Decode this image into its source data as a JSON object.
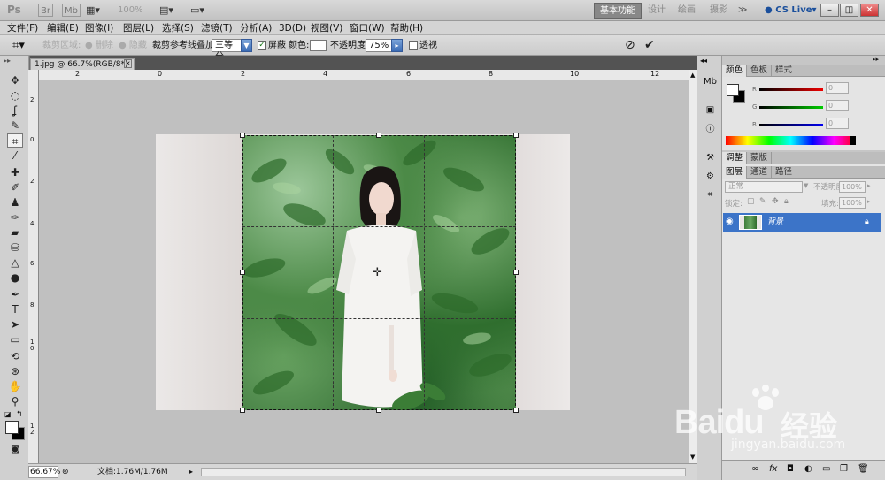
{
  "app": {
    "logo": "Ps",
    "br_label": "Br",
    "mb_label": "Mb",
    "zoom": "100%",
    "workspaces": [
      "基本功能",
      "设计",
      "绘画",
      "摄影"
    ],
    "more": "≫",
    "cslive": "CS Live▾",
    "win_controls": [
      "–",
      "◫",
      "✕"
    ]
  },
  "menu": [
    {
      "label": "文件(F)"
    },
    {
      "label": "编辑(E)"
    },
    {
      "label": "图像(I)"
    },
    {
      "label": "图层(L)"
    },
    {
      "label": "选择(S)"
    },
    {
      "label": "滤镜(T)"
    },
    {
      "label": "分析(A)"
    },
    {
      "label": "3D(D)"
    },
    {
      "label": "视图(V)"
    },
    {
      "label": "窗口(W)"
    },
    {
      "label": "帮助(H)"
    }
  ],
  "options": {
    "crop_area_label": "裁剪区域:",
    "delete_label": "删除",
    "hide_label": "隐藏",
    "overlay_label": "裁剪参考线叠加:",
    "overlay_value": "三等分",
    "shield_label": "屏蔽",
    "shield_checked": true,
    "color_label": "颜色:",
    "opacity_label": "不透明度:",
    "opacity_value": "75%",
    "perspective_label": "透视",
    "perspective_checked": false,
    "cancel_icon": "⊘",
    "commit_icon": "✔"
  },
  "document": {
    "tab_title": "1.jpg @ 66.7%(RGB/8*)",
    "ruler_top": [
      "2",
      "0",
      "2",
      "4",
      "6",
      "8",
      "10",
      "12"
    ],
    "ruler_left": [
      "2",
      "0",
      "2",
      "4",
      "6",
      "8",
      "1\n0",
      "1\n2"
    ],
    "zoom": "66.67%",
    "doc_info": "文档:1.76M/1.76M"
  },
  "color_panel": {
    "tabs": [
      "颜色",
      "色板",
      "样式"
    ],
    "channels": [
      {
        "name": "R",
        "value": "0",
        "color": "#c00000"
      },
      {
        "name": "G",
        "value": "0",
        "color": "#00a000"
      },
      {
        "name": "B",
        "value": "0",
        "color": "#0000c0"
      }
    ]
  },
  "adjust_panel": {
    "tabs": [
      "调整",
      "蒙版"
    ]
  },
  "layers_panel": {
    "tabs": [
      "图层",
      "通道",
      "路径"
    ],
    "blend_mode": "正常",
    "opacity_label": "不透明度:",
    "opacity_value": "100%",
    "lock_label": "锁定:",
    "fill_label": "填充:",
    "fill_value": "100%",
    "layers": [
      {
        "name": "背景",
        "locked": true
      }
    ]
  },
  "watermark": {
    "brand": "Baidu",
    "brand_cn": "经验",
    "url": "jingyan.baidu.com"
  },
  "colors": {
    "accent": "#3c74c8",
    "foreground": "#ffffff",
    "background": "#000000"
  }
}
